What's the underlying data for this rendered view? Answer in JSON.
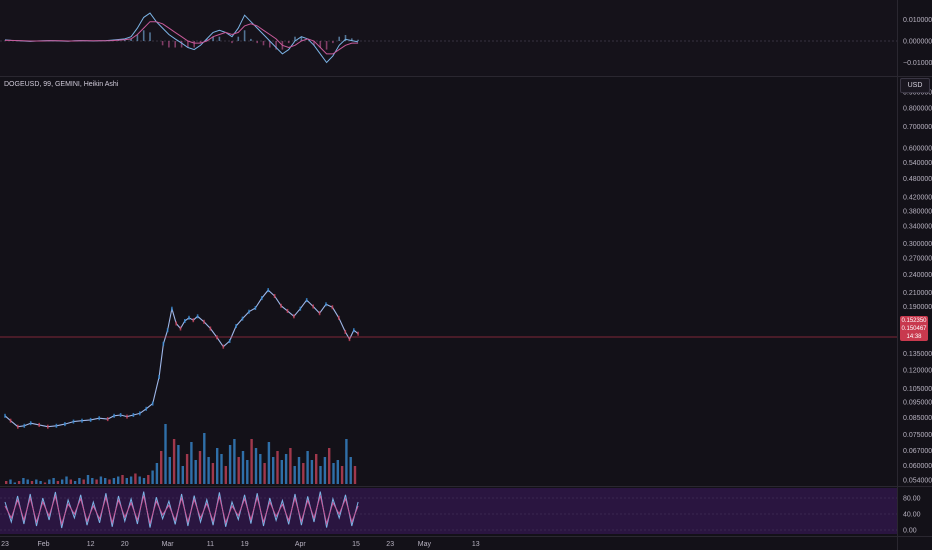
{
  "header": {
    "title": "DOGEUSD, 99, GEMINI, Heikin Ashi",
    "currency": "USD"
  },
  "price_badge": {
    "last_price": "0.152350",
    "line2": "0.150467",
    "countdown": "14:38"
  },
  "colors": {
    "background": "#131118",
    "price_line": "#9fb7e8",
    "last_price_line": "#c8394e",
    "volume_up": "#3a8fd8",
    "volume_down": "#d0455e",
    "oscillator_fill": "#2a1540",
    "macd_line": "#7cb4e6",
    "signal_line": "#c85a9a"
  },
  "chart_data": [
    {
      "type": "line",
      "name": "main-price",
      "title": "DOGEUSD, 99, GEMINI, Heikin Ashi",
      "y_scale": "log",
      "y_ticks": [
        {
          "v": 0.9,
          "label": "0.900000"
        },
        {
          "v": 0.8,
          "label": "0.800000"
        },
        {
          "v": 0.7,
          "label": "0.700000"
        },
        {
          "v": 0.6,
          "label": "0.600000"
        },
        {
          "v": 0.54,
          "label": "0.540000"
        },
        {
          "v": 0.48,
          "label": "0.480000"
        },
        {
          "v": 0.42,
          "label": "0.420000"
        },
        {
          "v": 0.38,
          "label": "0.380000"
        },
        {
          "v": 0.34,
          "label": "0.340000"
        },
        {
          "v": 0.3,
          "label": "0.300000"
        },
        {
          "v": 0.27,
          "label": "0.270000"
        },
        {
          "v": 0.24,
          "label": "0.240000"
        },
        {
          "v": 0.21,
          "label": "0.210000"
        },
        {
          "v": 0.19,
          "label": "0.190000"
        },
        {
          "v": 0.135,
          "label": "0.135000"
        },
        {
          "v": 0.12,
          "label": "0.120000"
        },
        {
          "v": 0.105,
          "label": "0.105000"
        },
        {
          "v": 0.095,
          "label": "0.095000"
        },
        {
          "v": 0.085,
          "label": "0.085000"
        },
        {
          "v": 0.075,
          "label": "0.075000"
        },
        {
          "v": 0.067,
          "label": "0.067000"
        },
        {
          "v": 0.06,
          "label": "0.060000"
        },
        {
          "v": 0.054,
          "label": "0.054000"
        }
      ],
      "last_price": 0.15235,
      "x_ticks": [
        {
          "t": 0.0,
          "label": "23"
        },
        {
          "t": 9.0,
          "label": "Feb"
        },
        {
          "t": 20.0,
          "label": "12"
        },
        {
          "t": 28.0,
          "label": "20"
        },
        {
          "t": 38.0,
          "label": "Mar"
        },
        {
          "t": 48.0,
          "label": "11"
        },
        {
          "t": 56.0,
          "label": "19"
        },
        {
          "t": 69.0,
          "label": "Apr"
        },
        {
          "t": 82.0,
          "label": "15"
        },
        {
          "t": 90.0,
          "label": "23"
        },
        {
          "t": 98.0,
          "label": "May"
        },
        {
          "t": 110.0,
          "label": "13"
        }
      ],
      "x": [
        0,
        1.3,
        3,
        4.5,
        6,
        8,
        10,
        12,
        14,
        16,
        18,
        20,
        22,
        24,
        25.5,
        27,
        28.5,
        30,
        31.5,
        33,
        34.5,
        36,
        37,
        38,
        39,
        40,
        41,
        42,
        43,
        44,
        45,
        46.5,
        48,
        49.5,
        51,
        52.5,
        54,
        55.5,
        57,
        58.5,
        60,
        61.5,
        63,
        64.5,
        66,
        67.5,
        69,
        70.5,
        72,
        73.5,
        75,
        76.5,
        78,
        79.5,
        80.5,
        81.5,
        82.5
      ],
      "values": [
        0.086,
        0.083,
        0.0795,
        0.08,
        0.0815,
        0.0805,
        0.0795,
        0.08,
        0.081,
        0.0825,
        0.083,
        0.0835,
        0.0845,
        0.084,
        0.086,
        0.0865,
        0.0855,
        0.0865,
        0.0875,
        0.0905,
        0.094,
        0.114,
        0.145,
        0.16,
        0.187,
        0.168,
        0.162,
        0.171,
        0.175,
        0.172,
        0.177,
        0.17,
        0.162,
        0.152,
        0.142,
        0.148,
        0.165,
        0.174,
        0.183,
        0.188,
        0.202,
        0.214,
        0.205,
        0.191,
        0.184,
        0.177,
        0.187,
        0.199,
        0.19,
        0.181,
        0.193,
        0.189,
        0.175,
        0.158,
        0.15,
        0.16,
        0.156
      ]
    },
    {
      "type": "bar",
      "name": "volume",
      "values": [
        2,
        3,
        1,
        2,
        4,
        3,
        2,
        3,
        2,
        1,
        3,
        4,
        2,
        3,
        5,
        3,
        2,
        4,
        3,
        6,
        4,
        3,
        5,
        4,
        3,
        4,
        5,
        6,
        4,
        5,
        7,
        5,
        4,
        6,
        9,
        14,
        22,
        40,
        18,
        30,
        26,
        12,
        20,
        28,
        16,
        22,
        34,
        18,
        14,
        24,
        20,
        12,
        26,
        30,
        18,
        22,
        16,
        30,
        24,
        20,
        14,
        28,
        18,
        22,
        16,
        20,
        24,
        12,
        18,
        14,
        22,
        16,
        20,
        12,
        18,
        24,
        14,
        16,
        12,
        30,
        18,
        12
      ]
    },
    {
      "type": "line",
      "name": "macd-oscillator",
      "y_ticks": [
        {
          "v": 0.01,
          "label": "0.010000"
        },
        {
          "v": 0.0,
          "label": "0.000000"
        },
        {
          "v": -0.01,
          "label": "−0.010000"
        }
      ],
      "series": [
        {
          "values": [
            0.0005,
            0.0003,
            0.0002,
            0.0,
            -0.0002,
            0.0,
            0.0001,
            0.0002,
            0.0001,
            0.0,
            -0.0001,
            0.0001,
            0.0002,
            0.0001,
            0.0,
            0.0001,
            0.0002,
            0.0004,
            0.0007,
            0.001,
            0.002,
            0.006,
            0.011,
            0.013,
            0.009,
            0.006,
            0.003,
            0.001,
            -0.001,
            -0.003,
            -0.004,
            -0.002,
            0.001,
            0.004,
            0.005,
            0.004,
            0.002,
            0.006,
            0.012,
            0.009,
            0.006,
            0.003,
            0.0,
            -0.003,
            -0.006,
            -0.004,
            0.0,
            0.002,
            0.001,
            -0.002,
            -0.006,
            -0.01,
            -0.007,
            -0.002,
            0.0008,
            0.0002,
            -0.0004
          ]
        },
        {
          "values": [
            0.0003,
            0.0003,
            0.0002,
            0.0001,
            0.0,
            0.0,
            0.0,
            0.0001,
            0.0001,
            0.0001,
            0.0,
            0.0,
            0.0001,
            0.0001,
            0.0001,
            0.0001,
            0.0001,
            0.0002,
            0.0004,
            0.0006,
            0.001,
            0.003,
            0.006,
            0.009,
            0.009,
            0.008,
            0.006,
            0.004,
            0.002,
            0.0,
            -0.001,
            -0.001,
            0.0,
            0.002,
            0.003,
            0.004,
            0.003,
            0.004,
            0.007,
            0.008,
            0.007,
            0.005,
            0.003,
            0.001,
            -0.002,
            -0.003,
            -0.002,
            0.0,
            0.001,
            0.0,
            -0.003,
            -0.006,
            -0.006,
            -0.004,
            -0.002,
            -0.001,
            -0.001
          ]
        }
      ]
    },
    {
      "type": "line",
      "name": "stochastic-rsi",
      "y_ticks": [
        {
          "v": 80,
          "label": "80.00"
        },
        {
          "v": 40,
          "label": "40.00"
        },
        {
          "v": 0,
          "label": "0.00"
        }
      ],
      "series": [
        {
          "values": [
            70,
            20,
            85,
            15,
            90,
            10,
            80,
            25,
            95,
            5,
            75,
            30,
            88,
            12,
            70,
            18,
            92,
            8,
            85,
            22,
            78,
            15,
            96,
            6,
            82,
            28,
            72,
            14,
            90,
            10,
            86,
            20,
            76,
            12,
            94,
            8,
            70,
            26,
            88,
            16,
            92,
            10,
            80,
            24,
            74,
            14,
            90,
            12,
            84,
            20,
            96,
            6,
            78,
            30,
            88,
            10,
            70
          ]
        },
        {
          "values": [
            60,
            30,
            75,
            25,
            80,
            20,
            70,
            35,
            85,
            15,
            65,
            40,
            78,
            22,
            60,
            28,
            82,
            18,
            75,
            32,
            68,
            25,
            86,
            16,
            72,
            38,
            62,
            24,
            80,
            20,
            76,
            30,
            66,
            22,
            84,
            18,
            60,
            36,
            78,
            26,
            82,
            20,
            70,
            34,
            64,
            24,
            80,
            22,
            74,
            30,
            86,
            16,
            68,
            40,
            78,
            20,
            60
          ]
        }
      ]
    }
  ]
}
